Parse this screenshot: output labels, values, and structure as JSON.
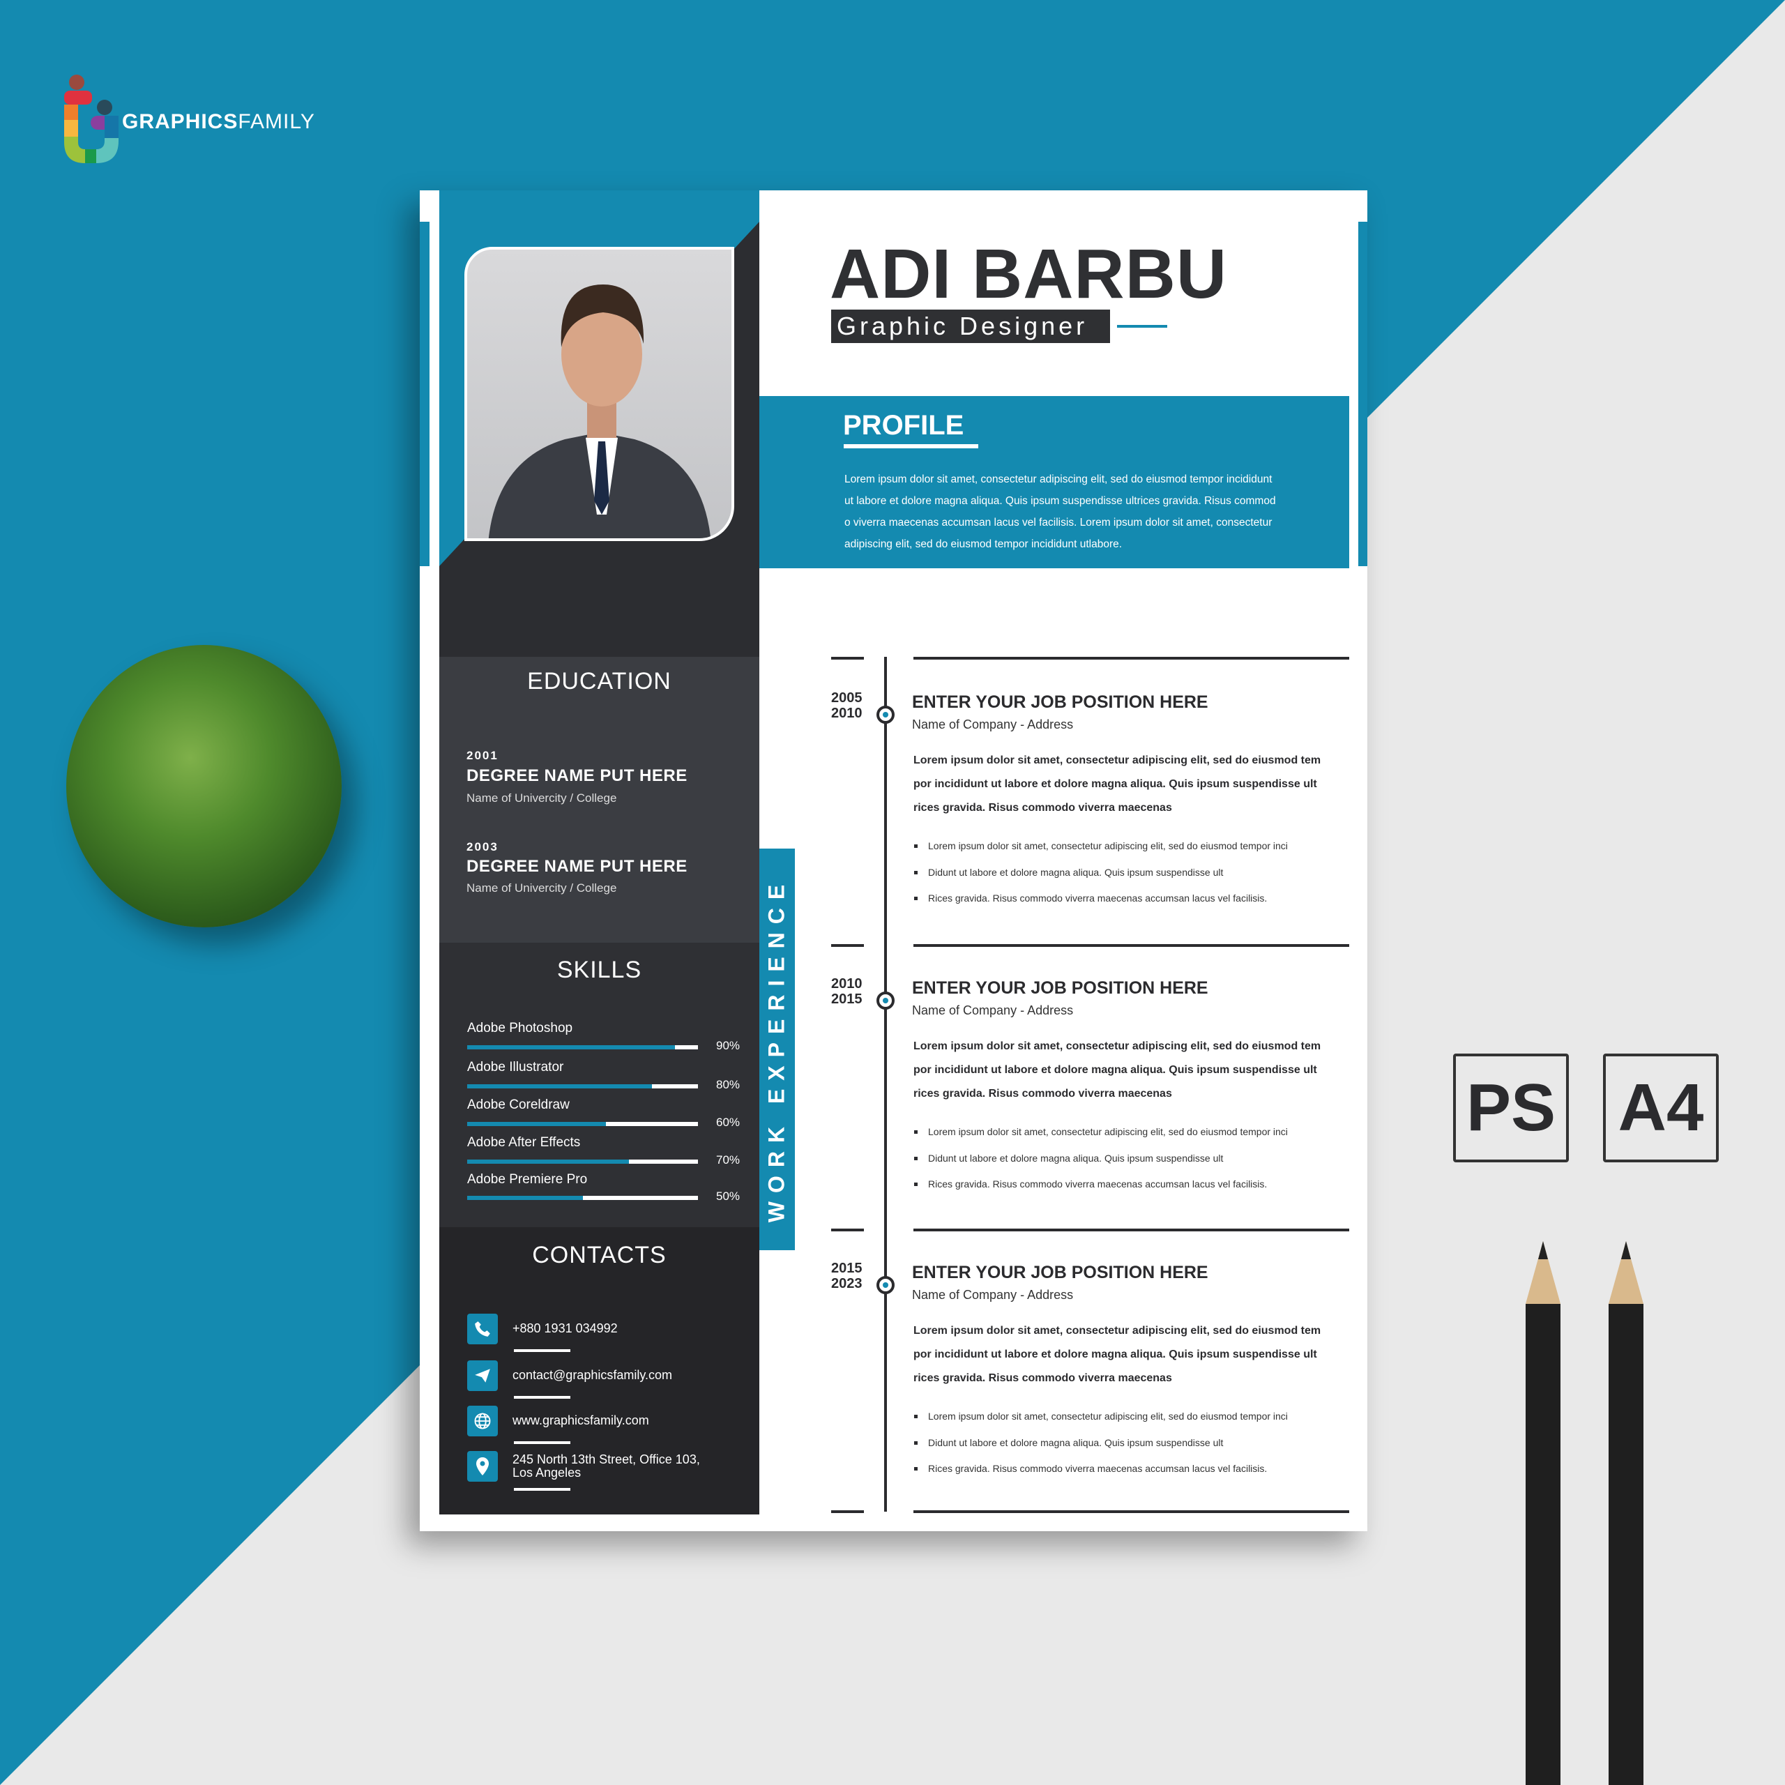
{
  "colors": {
    "accent": "#148ab0",
    "dark": "#2b2c30",
    "background": "#e9e9e9"
  },
  "brand": {
    "bold": "GRAPHICS",
    "light": "FAMILY"
  },
  "resume": {
    "name": "ADI BARBU",
    "title": "Graphic Designer",
    "profile": {
      "heading": "PROFILE",
      "lines": [
        "Lorem ipsum dolor sit amet, consectetur adipiscing elit, sed do eiusmod tempor incididunt",
        "ut labore et dolore magna aliqua. Quis ipsum suspendisse ultrices gravida. Risus commod",
        "o viverra maecenas accumsan lacus vel facilisis. Lorem ipsum dolor sit amet, consectetur",
        "adipiscing elit, sed do eiusmod tempor incididunt utlabore."
      ]
    },
    "education": {
      "heading": "EDUCATION",
      "items": [
        {
          "year": "2001",
          "degree": "DEGREE NAME PUT HERE",
          "school": "Name of Univercity / College"
        },
        {
          "year": "2003",
          "degree": "DEGREE NAME PUT HERE",
          "school": "Name of Univercity / College"
        }
      ]
    },
    "skills": {
      "heading": "SKILLS",
      "items": [
        {
          "name": "Adobe Photoshop",
          "percent": 90,
          "label": "90%"
        },
        {
          "name": "Adobe Illustrator",
          "percent": 80,
          "label": "80%"
        },
        {
          "name": "Adobe Coreldraw",
          "percent": 60,
          "label": "60%"
        },
        {
          "name": "Adobe After Effects",
          "percent": 70,
          "label": "70%"
        },
        {
          "name": "Adobe Premiere Pro",
          "percent": 50,
          "label": "50%"
        }
      ]
    },
    "contacts": {
      "heading": "CONTACTS",
      "items": [
        {
          "icon": "phone-icon",
          "text": "+880 1931 034992"
        },
        {
          "icon": "paper-plane-icon",
          "text": "contact@graphicsfamily.com"
        },
        {
          "icon": "globe-icon",
          "text": "www.graphicsfamily.com"
        },
        {
          "icon": "location-pin-icon",
          "text": "245 North 13th Street,  Office 103,",
          "text2": "Los Angeles"
        }
      ]
    },
    "work": {
      "heading": "WORK EXPERIENCE",
      "jobs": [
        {
          "from": "2005",
          "to": "2010",
          "title": "ENTER YOUR JOB POSITION HERE",
          "company": "Name of Company - Address",
          "body": [
            "Lorem ipsum dolor sit amet, consectetur adipiscing elit, sed do eiusmod tem",
            "por incididunt ut labore et dolore magna aliqua. Quis ipsum suspendisse ult",
            "rices gravida. Risus commodo viverra maecenas"
          ],
          "bullets": [
            "Lorem ipsum dolor sit amet, consectetur adipiscing elit, sed do eiusmod tempor inci",
            "Didunt ut labore et dolore magna aliqua. Quis ipsum suspendisse ult",
            "Rices gravida. Risus commodo viverra maecenas accumsan lacus vel facilisis."
          ]
        },
        {
          "from": "2010",
          "to": "2015",
          "title": "ENTER YOUR JOB POSITION HERE",
          "company": "Name of Company - Address",
          "body": [
            "Lorem ipsum dolor sit amet, consectetur adipiscing elit, sed do eiusmod tem",
            "por incididunt ut labore et dolore magna aliqua. Quis ipsum suspendisse ult",
            "rices gravida. Risus commodo viverra maecenas"
          ],
          "bullets": [
            "Lorem ipsum dolor sit amet, consectetur adipiscing elit, sed do eiusmod tempor inci",
            "Didunt ut labore et dolore magna aliqua. Quis ipsum suspendisse ult",
            "Rices gravida. Risus commodo viverra maecenas accumsan lacus vel facilisis."
          ]
        },
        {
          "from": "2015",
          "to": "2023",
          "title": "ENTER YOUR JOB POSITION HERE",
          "company": "Name of Company - Address",
          "body": [
            "Lorem ipsum dolor sit amet, consectetur adipiscing elit, sed do eiusmod tem",
            "por incididunt ut labore et dolore magna aliqua. Quis ipsum suspendisse ult",
            "rices gravida. Risus commodo viverra maecenas"
          ],
          "bullets": [
            "Lorem ipsum dolor sit amet, consectetur adipiscing elit, sed do eiusmod tempor inci",
            "Didunt ut labore et dolore magna aliqua. Quis ipsum suspendisse ult",
            "Rices gravida. Risus commodo viverra maecenas accumsan lacus vel facilisis."
          ]
        }
      ]
    }
  },
  "badges": [
    "PS",
    "A4"
  ]
}
